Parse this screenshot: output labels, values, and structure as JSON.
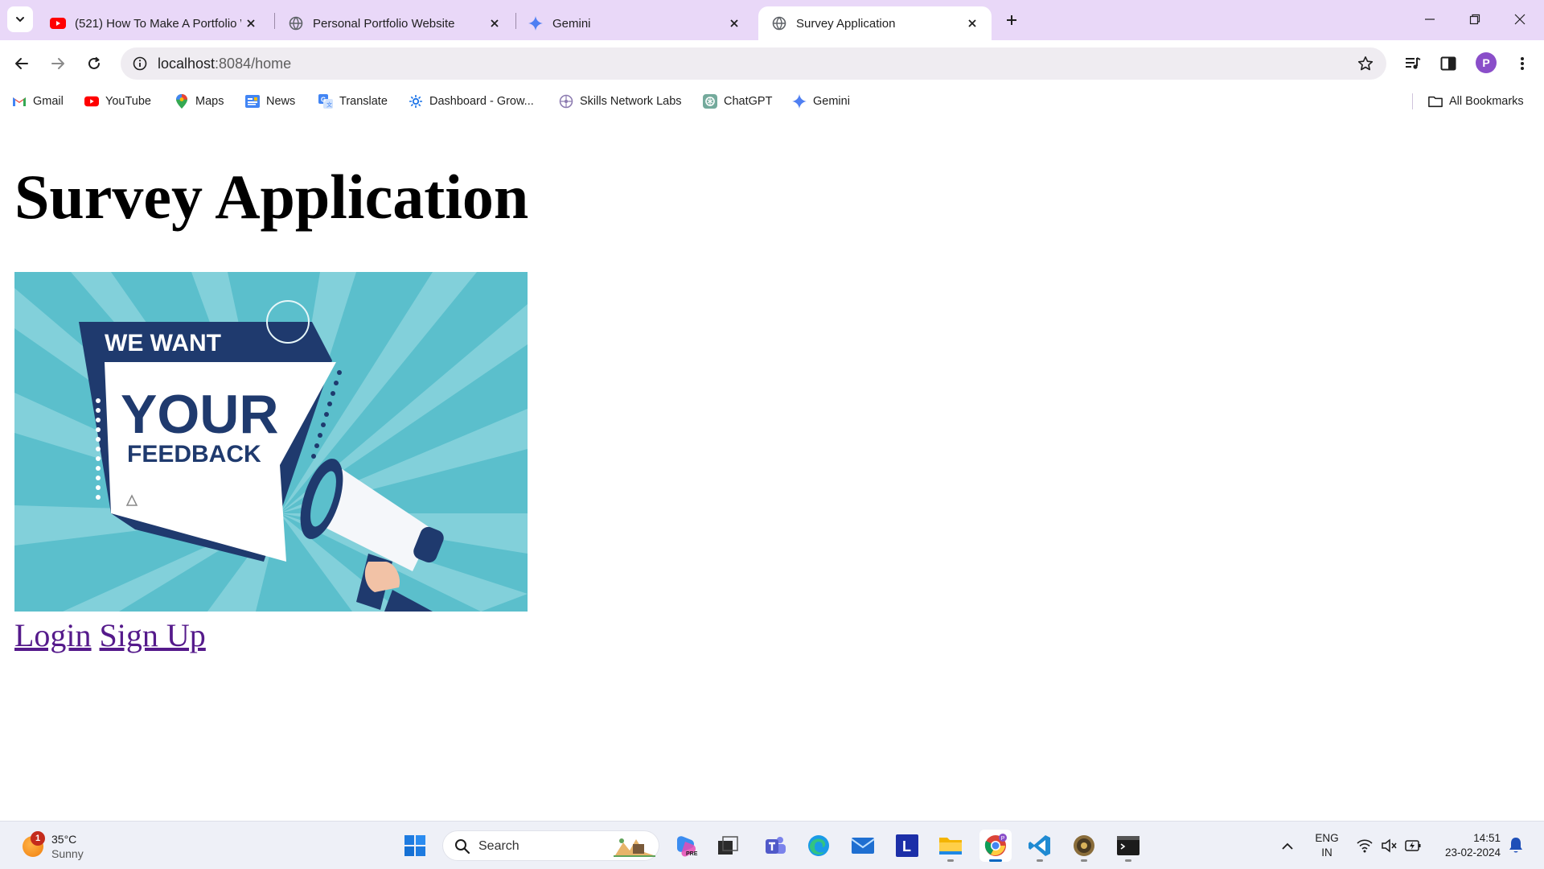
{
  "browser": {
    "tabs": [
      {
        "title": "(521) How To Make A Portfolio W",
        "favicon": "youtube-icon",
        "active": false
      },
      {
        "title": "Personal Portfolio Website",
        "favicon": "globe-icon",
        "active": false
      },
      {
        "title": "Gemini",
        "favicon": "gemini-icon",
        "active": false
      },
      {
        "title": "Survey Application",
        "favicon": "globe-icon",
        "active": true
      }
    ],
    "address": {
      "host": "localhost",
      "path": ":8084/home"
    },
    "profile_initial": "P",
    "bookmarks": [
      {
        "label": "Gmail",
        "icon": "gmail-icon"
      },
      {
        "label": "YouTube",
        "icon": "youtube-icon"
      },
      {
        "label": "Maps",
        "icon": "maps-icon"
      },
      {
        "label": "News",
        "icon": "news-icon"
      },
      {
        "label": "Translate",
        "icon": "translate-icon"
      },
      {
        "label": "Dashboard - Grow...",
        "icon": "dashboard-icon"
      },
      {
        "label": "Skills Network Labs",
        "icon": "skills-network-icon"
      },
      {
        "label": "ChatGPT",
        "icon": "chatgpt-icon"
      },
      {
        "label": "Gemini",
        "icon": "gemini-icon"
      }
    ],
    "all_bookmarks_label": "All Bookmarks"
  },
  "page": {
    "title": "Survey Application",
    "hero_image": {
      "line1": "WE WANT",
      "line2": "YOUR",
      "line3": "FEEDBACK"
    },
    "links": {
      "login": "Login",
      "signup": "Sign Up"
    }
  },
  "taskbar": {
    "weather": {
      "temp": "35°C",
      "condition": "Sunny",
      "badge": "1"
    },
    "search_placeholder": "Search",
    "language": {
      "line1": "ENG",
      "line2": "IN"
    },
    "time": "14:51",
    "date": "23-02-2024",
    "profile_badge": "P"
  },
  "colors": {
    "tabstrip": "#e9d8f8",
    "link_visited": "#551a8b",
    "hero_bg": "#5bbfcc",
    "hero_navy": "#1f3a6e"
  }
}
